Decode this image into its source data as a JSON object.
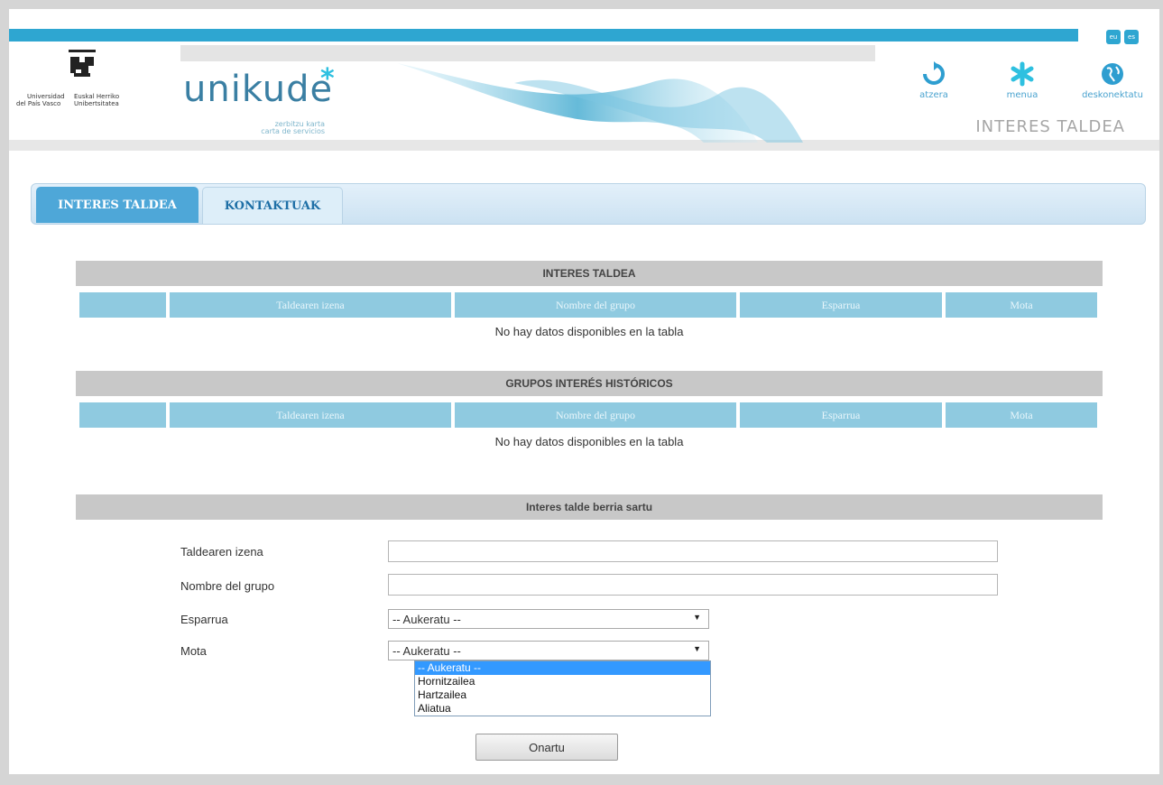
{
  "header": {
    "lang_eu": "eu",
    "lang_es": "es",
    "uni_text_1a": "Universidad",
    "uni_text_1b": "del País Vasco",
    "uni_text_2a": "Euskal Herriko",
    "uni_text_2b": "Unibertsitatea",
    "brand": "unikude",
    "brand_star": "*",
    "brand_sub_1": "zerbitzu karta",
    "brand_sub_2": "carta de servicios",
    "nav": [
      {
        "label": "atzera",
        "icon": "back-arrow-icon"
      },
      {
        "label": "menua",
        "icon": "asterisk-menu-icon"
      },
      {
        "label": "deskonektatu",
        "icon": "globe-icon"
      }
    ],
    "page_caption": "INTERES TALDEA",
    "accent_color": "#2ea6d1"
  },
  "tabs": [
    {
      "label": "INTERES TALDEA",
      "active": true
    },
    {
      "label": "KONTAKTUAK",
      "active": false
    }
  ],
  "table1": {
    "title": "INTERES TALDEA",
    "columns": [
      "",
      "Taldearen izena",
      "Nombre del grupo",
      "Esparrua",
      "Mota"
    ],
    "empty_text": "No hay datos disponibles en la tabla"
  },
  "table2": {
    "title": "GRUPOS INTERÉS HISTÓRICOS",
    "columns": [
      "",
      "Taldearen izena",
      "Nombre del grupo",
      "Esparrua",
      "Mota"
    ],
    "empty_text": "No hay datos disponibles en la tabla"
  },
  "form": {
    "title": "Interes talde berria sartu",
    "label_taldearen": "Taldearen izena",
    "label_nombre": "Nombre del grupo",
    "label_esparrua": "Esparrua",
    "label_mota": "Mota",
    "esparrua_value": "-- Aukeratu --",
    "mota_value": "-- Aukeratu --",
    "mota_options": [
      "-- Aukeratu --",
      "Hornitzailea",
      "Hartzailea",
      "Aliatua"
    ],
    "submit_label": "Onartu"
  }
}
